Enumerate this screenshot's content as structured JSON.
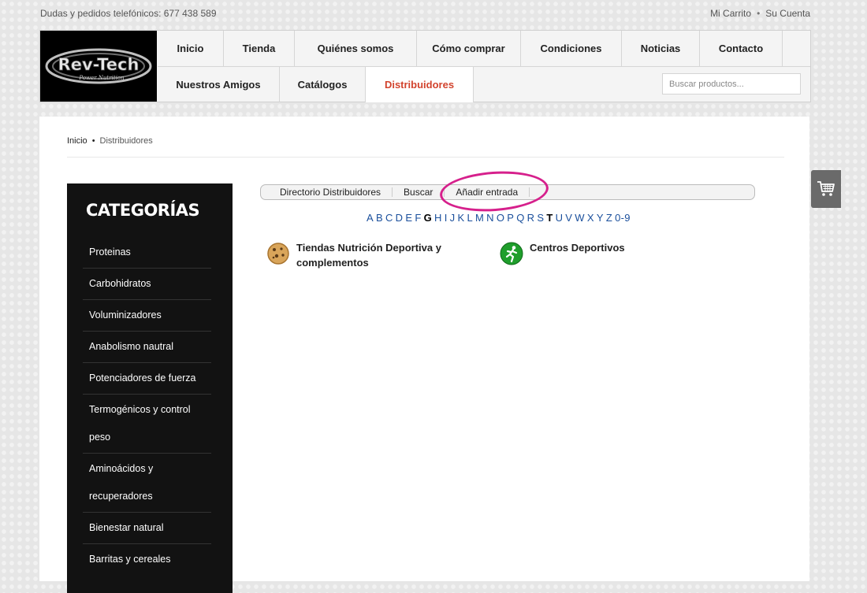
{
  "topbar": {
    "phone": "Dudas y pedidos telefónicos: 677 438 589",
    "cart_link": "Mi Carrito",
    "separator": "•",
    "account_link": "Su Cuenta"
  },
  "logo": {
    "text": "Rev-Tech",
    "subtext": "Power Nutrition"
  },
  "nav": {
    "row1": [
      "Inicio",
      "Tienda",
      "Quiénes somos",
      "Cómo comprar",
      "Condiciones",
      "Noticias",
      "Contacto"
    ],
    "row2": [
      "Nuestros Amigos",
      "Catálogos",
      "Distribuidores"
    ],
    "active": "Distribuidores"
  },
  "search": {
    "placeholder": "Buscar productos..."
  },
  "breadcrumb": {
    "home": "Inicio",
    "separator": "•",
    "current": "Distribuidores"
  },
  "sidebar": {
    "title": "CATEGORÍAS",
    "items": [
      "Proteinas",
      "Carbohidratos",
      "Voluminizadores",
      "Anabolismo nautral",
      "Potenciadores de fuerza",
      "Termogénicos y control peso",
      "Aminoácidos y recuperadores",
      "Bienestar natural",
      "Barritas y cereales"
    ]
  },
  "directory": {
    "tabs": [
      "Directorio Distribuidores",
      "Buscar",
      "Añadir entrada"
    ],
    "letters": [
      "A",
      "B",
      "C",
      "D",
      "E",
      "F",
      "G",
      "H",
      "I",
      "J",
      "K",
      "L",
      "M",
      "N",
      "O",
      "P",
      "Q",
      "R",
      "S",
      "T",
      "U",
      "V",
      "W",
      "X",
      "Y",
      "Z",
      "0-9"
    ],
    "bold_letters": [
      "G",
      "T"
    ],
    "categories": [
      {
        "label": "Tiendas Nutrición Deportiva y complementos",
        "icon": "cookie-icon"
      },
      {
        "label": "Centros Deportivos",
        "icon": "runner-icon"
      }
    ]
  },
  "colors": {
    "active_nav": "#d2432d",
    "highlight_circle": "#d6208c",
    "sidebar_bg": "#121212",
    "link_blue": "#1a4f9c"
  }
}
